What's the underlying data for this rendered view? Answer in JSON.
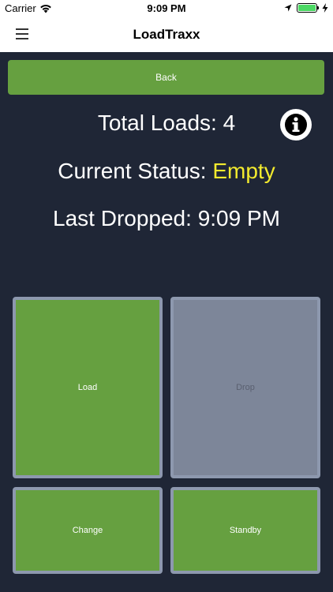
{
  "status_bar": {
    "carrier": "Carrier",
    "time": "9:09 PM"
  },
  "nav": {
    "title": "LoadTraxx"
  },
  "back_label": "Back",
  "stats": {
    "total_loads_label": "Total Loads:",
    "total_loads_value": "4",
    "current_status_label": "Current Status:",
    "current_status_value": "Empty",
    "last_dropped_label": "Last Dropped:",
    "last_dropped_value": "9:09 PM"
  },
  "tiles": {
    "load": "Load",
    "drop": "Drop",
    "change": "Change",
    "standby": "Standby"
  },
  "colors": {
    "background": "#1f2636",
    "green": "#66a040",
    "disabled": "#7d8699",
    "status_highlight": "#f2ea2e"
  }
}
